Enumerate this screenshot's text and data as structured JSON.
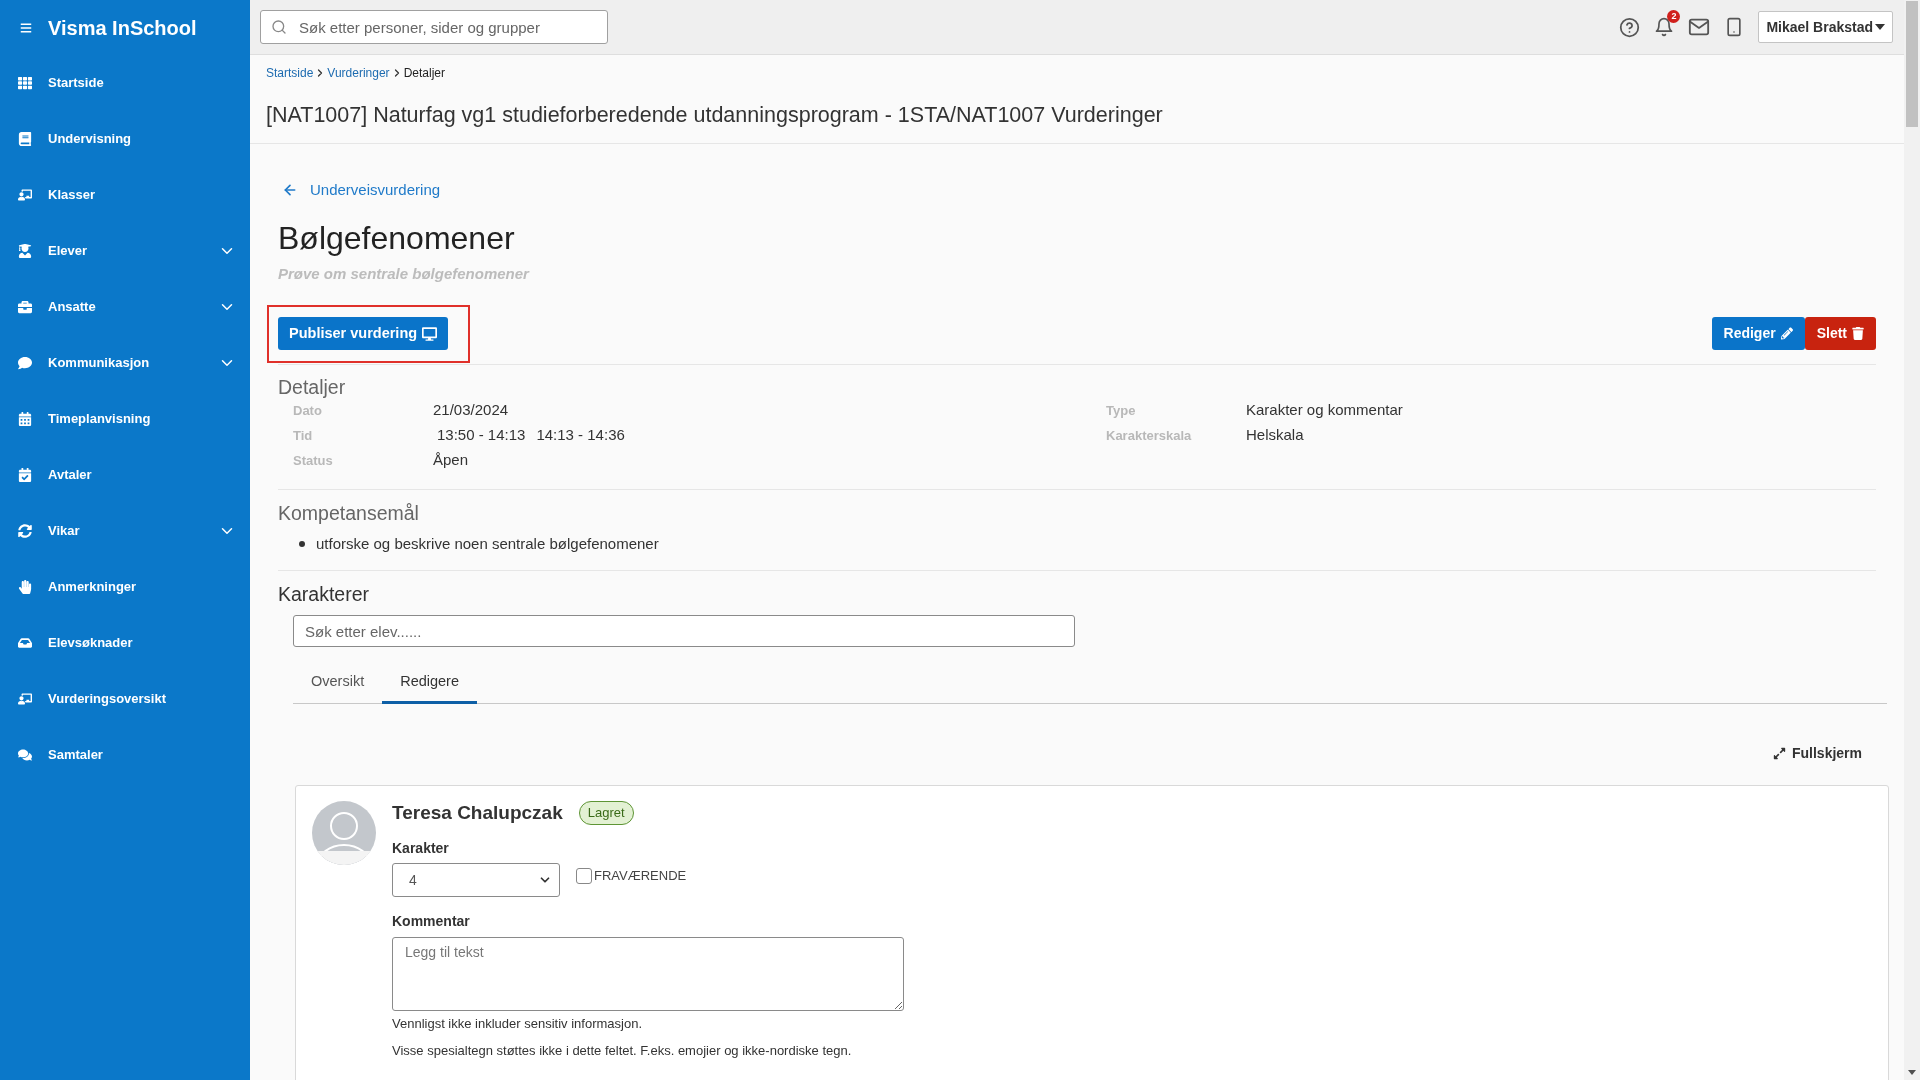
{
  "sidebar": {
    "brand": "Visma InSchool",
    "items": [
      {
        "label": "Startside",
        "expandable": false
      },
      {
        "label": "Undervisning",
        "expandable": false
      },
      {
        "label": "Klasser",
        "expandable": false
      },
      {
        "label": "Elever",
        "expandable": true
      },
      {
        "label": "Ansatte",
        "expandable": true
      },
      {
        "label": "Kommunikasjon",
        "expandable": true
      },
      {
        "label": "Timeplanvisning",
        "expandable": false
      },
      {
        "label": "Avtaler",
        "expandable": false
      },
      {
        "label": "Vikar",
        "expandable": true
      },
      {
        "label": "Anmerkninger",
        "expandable": false
      },
      {
        "label": "Elevsøknader",
        "expandable": false
      },
      {
        "label": "Vurderingsoversikt",
        "expandable": false
      },
      {
        "label": "Samtaler",
        "expandable": false
      }
    ]
  },
  "topbar": {
    "search": {
      "placeholder": "Søk etter personer, sider og grupper"
    },
    "notification_count": "2",
    "user_menu": "Mikael Brakstad"
  },
  "breadcrumb": [
    {
      "label": "Startside",
      "current": false
    },
    {
      "label": "Vurderinger",
      "current": false
    },
    {
      "label": "Detaljer",
      "current": true
    }
  ],
  "page_title": "[NAT1007] Naturfag vg1 studieforberedende utdanningsprogram - 1STA/NAT1007 Vurderinger",
  "back_link": "Underveisvurdering",
  "assessment": {
    "title": "Bølgefenomener",
    "subtitle": "Prøve om sentrale bølgefenomener"
  },
  "publish_button": {
    "label": "Publiser vurdering",
    "highlighted": true
  },
  "actions": [
    {
      "label": "Rediger",
      "kind": "edit"
    },
    {
      "label": "Slett",
      "kind": "delete"
    }
  ],
  "details": {
    "heading": "Detaljer",
    "left": [
      {
        "label": "Dato",
        "values": [
          "21/03/2024"
        ]
      },
      {
        "label": "Tid",
        "values": [
          "13:50 - 14:13",
          "14:13 - 14:36"
        ]
      },
      {
        "label": "Status",
        "values": [
          "Åpen"
        ]
      }
    ],
    "right": [
      {
        "label": "Type",
        "values": [
          "Karakter og kommentar"
        ]
      },
      {
        "label": "Karakterskala",
        "values": [
          "Helskala"
        ]
      }
    ]
  },
  "competence_goals": {
    "heading": "Kompetansemål",
    "items": [
      "utforske og beskrive noen sentrale bølgefenomener"
    ]
  },
  "grades": {
    "heading": "Karakterer",
    "search": {
      "placeholder": "Søk etter elev......"
    },
    "tabs": [
      {
        "label": "Oversikt",
        "selected": false
      },
      {
        "label": "Redigere",
        "selected": true
      }
    ],
    "fullscreen": "Fullskjerm",
    "students": [
      {
        "name": "Teresa Chalupczak",
        "status": "Lagret",
        "grade_label": "Karakter",
        "grade": "4",
        "absent_label": "FRAVÆRENDE",
        "absent": false,
        "comment_label": "Kommentar",
        "comment_placeholder": "Legg til tekst",
        "notes": [
          "Vennligst ikke inkluder sensitiv informasjon.",
          "Visse spesialtegn støttes ikke i dette feltet. F.eks. emojier og ikke-nordiske tegn."
        ]
      }
    ]
  }
}
